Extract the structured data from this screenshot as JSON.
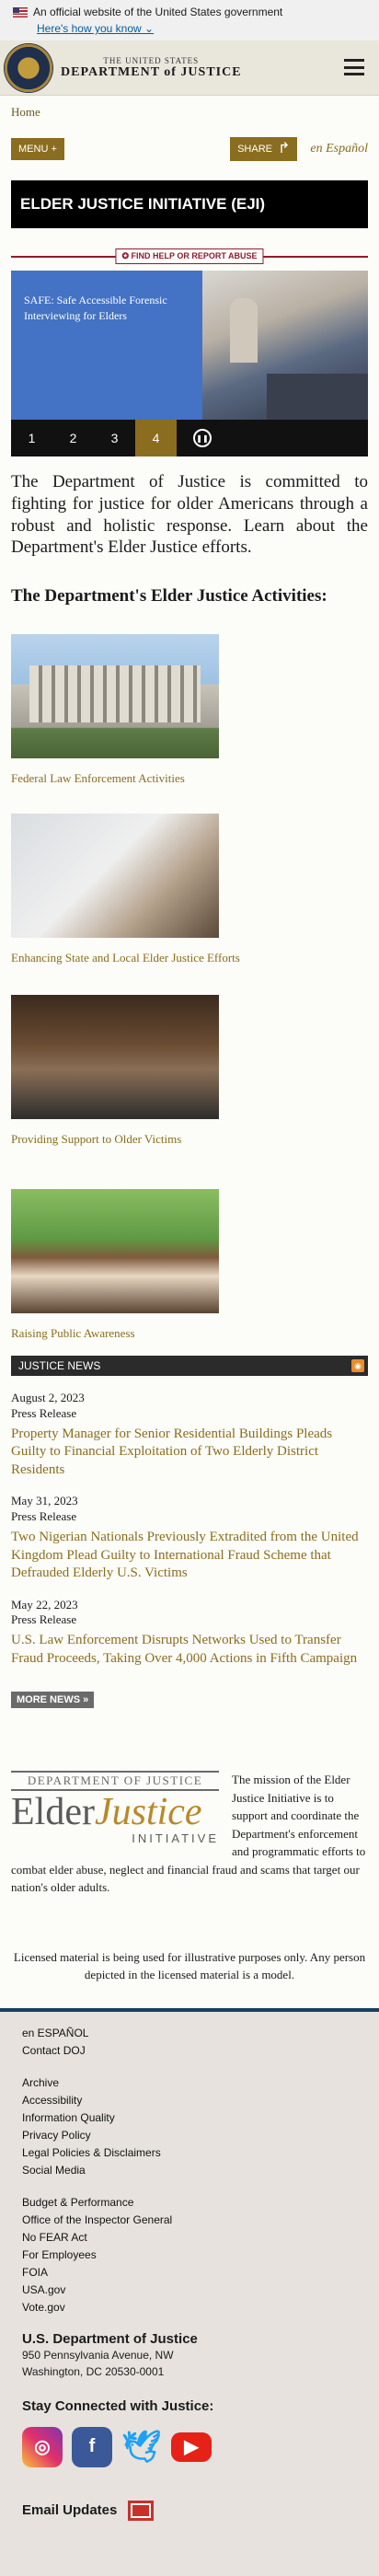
{
  "gov_banner": {
    "text": "An official website of the United States government",
    "link": "Here's how you know"
  },
  "header": {
    "small": "THE UNITED STATES",
    "big": "DEPARTMENT of JUSTICE"
  },
  "breadcrumb": "Home",
  "toolbar": {
    "menu": "MENU +",
    "share": "SHARE",
    "espanol": "en Español"
  },
  "page_title": "ELDER JUSTICE INITIATIVE (EJI)",
  "help_button": "FIND HELP OR REPORT ABUSE",
  "carousel": {
    "caption": "SAFE: Safe Accessible Forensic Interviewing for Elders",
    "numbers": [
      "1",
      "2",
      "3",
      "4"
    ],
    "active": "4"
  },
  "intro": "The Department of Justice is committed to fighting for justice for older Americans through a robust and holistic response. Learn about the Department's Elder Justice efforts.",
  "activities_heading": "The Department's Elder Justice Activities:",
  "activities": [
    "Federal Law Enforcement Activities",
    "Enhancing State and Local Elder Justice Efforts",
    "Providing Support to Older Victims",
    "Raising Public Awareness"
  ],
  "news": {
    "header": "JUSTICE NEWS",
    "items": [
      {
        "date": "August 2, 2023",
        "type": "Press Release",
        "headline": "Property Manager for Senior Residential Buildings Pleads Guilty to Financial Exploitation of Two Elderly District Residents"
      },
      {
        "date": "May 31, 2023",
        "type": "Press Release",
        "headline": "Two Nigerian Nationals Previously Extradited from the United Kingdom Plead Guilty to International Fraud Scheme that Defrauded Elderly U.S. Victims"
      },
      {
        "date": "May 22, 2023",
        "type": "Press Release",
        "headline": "U.S. Law Enforcement Disrupts Networks Used to Transfer Fraud Proceeds, Taking Over 4,000 Actions in Fifth Campaign"
      }
    ],
    "more": "MORE NEWS »"
  },
  "eji_logo": {
    "dept": "DEPARTMENT OF JUSTICE",
    "elder": "Elder",
    "justice": "Justice",
    "initiative": "INITIATIVE"
  },
  "eji_mission": "The mission of the Elder Justice Initiative is to support and coordinate the Department's enforcement and programmatic efforts to combat elder abuse, neglect and financial fraud and scams that target our nation's older adults.",
  "license_note": "Licensed material is being used for illustrative purposes only. Any person depicted in the licensed material is a model.",
  "footer": {
    "group1": [
      "en ESPAÑOL",
      "Contact DOJ"
    ],
    "group2": [
      "Archive",
      "Accessibility",
      "Information Quality",
      "Privacy Policy",
      "Legal Policies & Disclaimers",
      "Social Media"
    ],
    "group3": [
      "Budget & Performance",
      "Office of the Inspector General",
      "No FEAR Act",
      "For Employees",
      "FOIA",
      "USA.gov",
      "Vote.gov"
    ],
    "org": "U.S. Department of Justice",
    "address1": "950 Pennsylvania Avenue, NW",
    "address2": "Washington, DC 20530-0001",
    "stay": "Stay Connected with Justice:",
    "email": "Email Updates"
  }
}
